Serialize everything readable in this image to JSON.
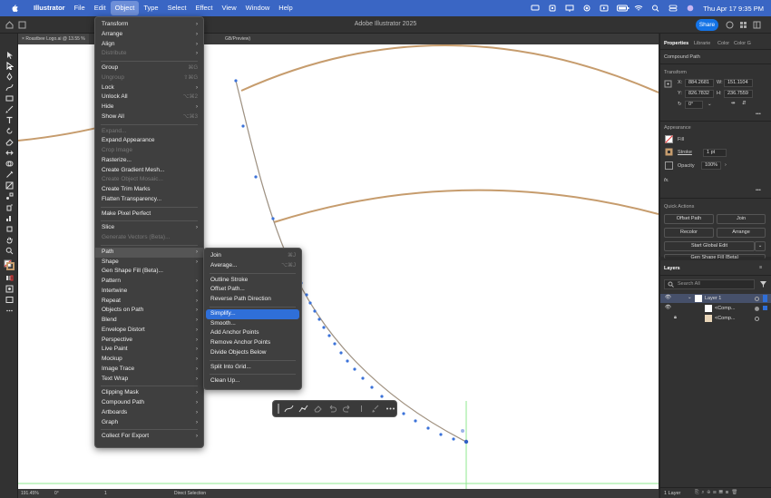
{
  "menubar": {
    "app_name": "Illustrator",
    "items": [
      "File",
      "Edit",
      "Object",
      "Type",
      "Select",
      "Effect",
      "View",
      "Window",
      "Help"
    ],
    "active_item": "Object",
    "clock": "Thu Apr 17  9:35 PM"
  },
  "titlebar": {
    "title": "Adobe Illustrator 2025",
    "share_label": "Share"
  },
  "document_tab": {
    "label": "Roastbee Logo.ai @ 13.55 %",
    "suffix": "GB/Preview)"
  },
  "object_menu": [
    {
      "label": "Transform",
      "submenu": true
    },
    {
      "label": "Arrange",
      "submenu": true
    },
    {
      "label": "Align",
      "submenu": true
    },
    {
      "label": "Distribute",
      "submenu": true,
      "disabled": true
    },
    {
      "separator": true
    },
    {
      "label": "Group",
      "shortcut": "⌘G"
    },
    {
      "label": "Ungroup",
      "shortcut": "⇧⌘G",
      "disabled": true
    },
    {
      "label": "Lock",
      "submenu": true
    },
    {
      "label": "Unlock All",
      "shortcut": "⌥⌘2"
    },
    {
      "label": "Hide",
      "submenu": true
    },
    {
      "label": "Show All",
      "shortcut": "⌥⌘3"
    },
    {
      "separator": true
    },
    {
      "label": "Expand...",
      "disabled": true
    },
    {
      "label": "Expand Appearance"
    },
    {
      "label": "Crop Image",
      "disabled": true
    },
    {
      "label": "Rasterize..."
    },
    {
      "label": "Create Gradient Mesh..."
    },
    {
      "label": "Create Object Mosaic...",
      "disabled": true
    },
    {
      "label": "Create Trim Marks"
    },
    {
      "label": "Flatten Transparency..."
    },
    {
      "separator": true
    },
    {
      "label": "Make Pixel Perfect"
    },
    {
      "separator": true
    },
    {
      "label": "Slice",
      "submenu": true
    },
    {
      "label": "Generate Vectors (Beta)...",
      "disabled": true
    },
    {
      "separator": true
    },
    {
      "label": "Path",
      "submenu": true,
      "selected": true
    },
    {
      "label": "Shape",
      "submenu": true
    },
    {
      "label": "Gen Shape Fill (Beta)..."
    },
    {
      "label": "Pattern",
      "submenu": true
    },
    {
      "label": "Intertwine",
      "submenu": true
    },
    {
      "label": "Repeat",
      "submenu": true
    },
    {
      "label": "Objects on Path",
      "submenu": true
    },
    {
      "label": "Blend",
      "submenu": true
    },
    {
      "label": "Envelope Distort",
      "submenu": true
    },
    {
      "label": "Perspective",
      "submenu": true
    },
    {
      "label": "Live Paint",
      "submenu": true
    },
    {
      "label": "Mockup",
      "submenu": true
    },
    {
      "label": "Image Trace",
      "submenu": true
    },
    {
      "label": "Text Wrap",
      "submenu": true
    },
    {
      "separator": true
    },
    {
      "label": "Clipping Mask",
      "submenu": true
    },
    {
      "label": "Compound Path",
      "submenu": true
    },
    {
      "label": "Artboards",
      "submenu": true
    },
    {
      "label": "Graph",
      "submenu": true
    },
    {
      "separator": true
    },
    {
      "label": "Collect For Export",
      "submenu": true
    }
  ],
  "path_submenu": [
    {
      "label": "Join",
      "shortcut": "⌘J"
    },
    {
      "label": "Average...",
      "shortcut": "⌥⌘J"
    },
    {
      "separator": true
    },
    {
      "label": "Outline Stroke"
    },
    {
      "label": "Offset Path..."
    },
    {
      "label": "Reverse Path Direction"
    },
    {
      "separator": true
    },
    {
      "label": "Simplify...",
      "highlighted": true
    },
    {
      "label": "Smooth..."
    },
    {
      "label": "Add Anchor Points"
    },
    {
      "label": "Remove Anchor Points"
    },
    {
      "label": "Divide Objects Below"
    },
    {
      "separator": true
    },
    {
      "label": "Split Into Grid..."
    },
    {
      "separator": true
    },
    {
      "label": "Clean Up..."
    }
  ],
  "properties_panel": {
    "tabs": [
      "Properties",
      "Librarie",
      "Color",
      "Color G"
    ],
    "object_type": "Compound Path",
    "transform_label": "Transform",
    "x_label": "X:",
    "x_value": "884.2681",
    "y_label": "Y:",
    "y_value": "826.7832",
    "w_label": "W:",
    "w_value": "151.1104",
    "h_label": "H:",
    "h_value": "236.7559",
    "rotate_value": "0°",
    "appearance_label": "Appearance",
    "fill_label": "Fill",
    "stroke_label": "Stroke",
    "stroke_value": "1 pt",
    "opacity_label": "Opacity",
    "opacity_value": "100%",
    "fx_label": "fx.",
    "quick_actions_label": "Quick Actions",
    "offset_path_label": "Offset Path",
    "join_label": "Join",
    "recolor_label": "Recolor",
    "arrange_label": "Arrange",
    "global_edit_label": "Start Global Edit",
    "gen_shape_label": "Gen Shape Fill (Beta)"
  },
  "layers_panel": {
    "title": "Layers",
    "search_placeholder": "Search All",
    "rows": [
      {
        "name": "Layer 1"
      },
      {
        "name": "<Comp..."
      },
      {
        "name": "<Comp..."
      }
    ],
    "footer": "1 Layer"
  },
  "statusbar": {
    "zoom": "191.45%",
    "rotation": "0°",
    "artboard": "1",
    "tool": "Direct Selection"
  },
  "colors": {
    "menubar": "#3a66c4",
    "highlight": "#2f6fd8",
    "tan_stroke": "#c69c6d",
    "anchor_blue": "#3b72d9",
    "guide_green": "#8fe88f"
  }
}
